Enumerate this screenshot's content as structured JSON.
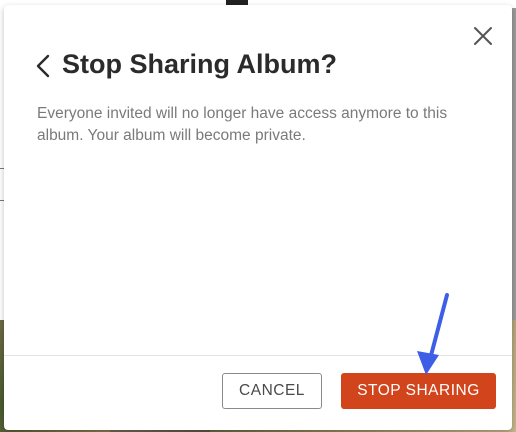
{
  "dialog": {
    "title": "Stop Sharing Album?",
    "message": "Everyone invited will no longer have access anymore to this album. Your album will become private.",
    "cancel_label": "CANCEL",
    "confirm_label": "STOP SHARING"
  },
  "icons": {
    "back": "chevron-left-icon",
    "close": "close-icon",
    "annotation": "arrow-down-icon"
  },
  "colors": {
    "primary_button": "#d2441b",
    "annotation_arrow": "#3d5ee6",
    "title_text": "#2b2b2b",
    "body_text": "#7a7a7a"
  }
}
